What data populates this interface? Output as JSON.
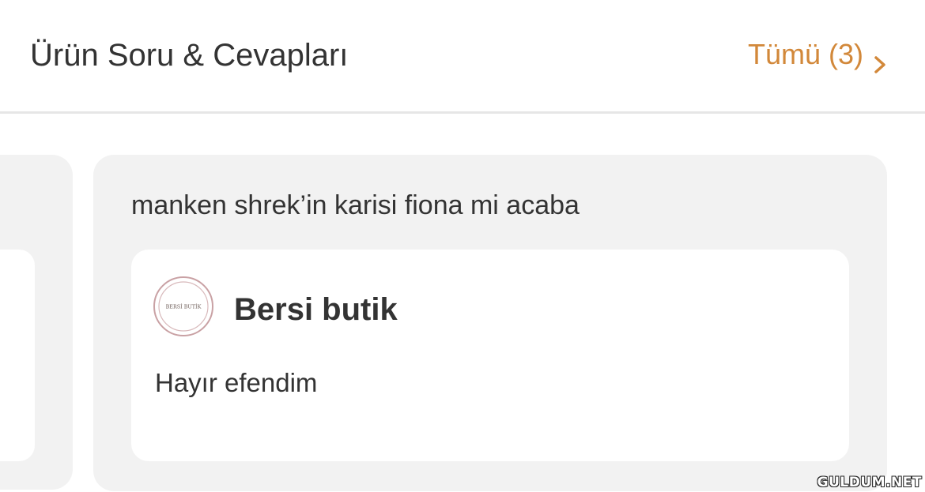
{
  "header": {
    "title": "Ürün Soru & Cevapları",
    "see_all_label": "Tümü (3)",
    "see_all_icon": "chevron-right-icon",
    "accent_color": "#d2883a"
  },
  "qa_cards": [
    {
      "question": "manken shrek’in karisi fiona mi acaba",
      "answer": {
        "seller_name": "Bersi butik",
        "seller_logo_text": "BERSİ BUTİK",
        "text": "Hayır efendim"
      }
    }
  ],
  "watermark": "GULDUM.NET"
}
